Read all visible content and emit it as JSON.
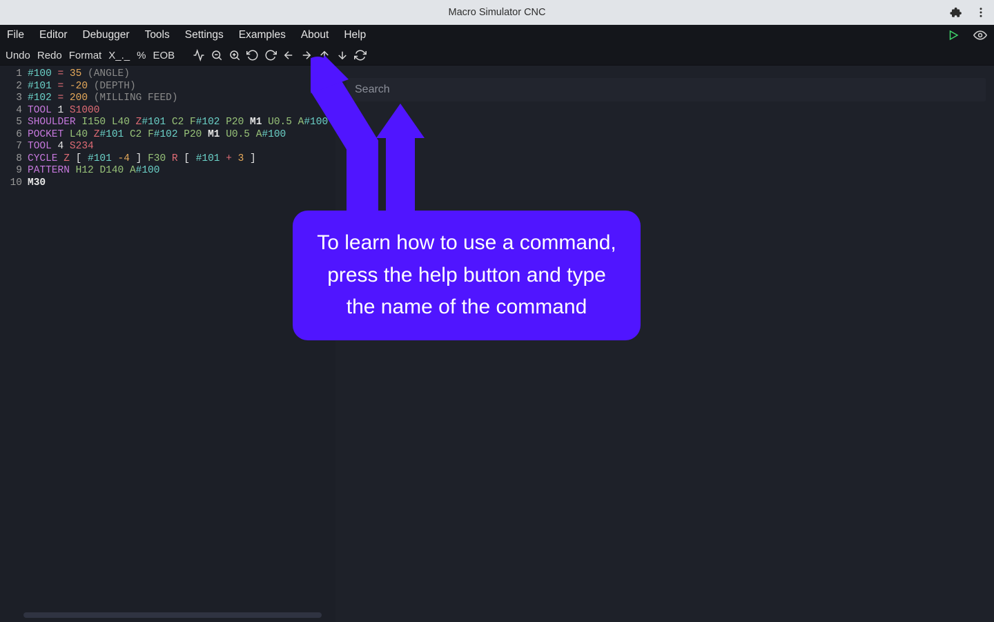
{
  "titlebar": {
    "title": "Macro Simulator CNC"
  },
  "menu": {
    "items": [
      "File",
      "Editor",
      "Debugger",
      "Tools",
      "Settings",
      "Examples",
      "About",
      "Help"
    ]
  },
  "toolbar": {
    "undo": "Undo",
    "redo": "Redo",
    "format": "Format",
    "xdot": "X_._",
    "percent": "%",
    "eob": "EOB"
  },
  "search": {
    "placeholder": "Search"
  },
  "callout": {
    "text": "To learn how to use a command, press the help button and type the name of the command"
  },
  "code": {
    "lines": [
      [
        {
          "t": "#100",
          "c": "cyan"
        },
        {
          "t": " "
        },
        {
          "t": "=",
          "c": "red"
        },
        {
          "t": " "
        },
        {
          "t": "35",
          "c": "orange"
        },
        {
          "t": " "
        },
        {
          "t": "(ANGLE)",
          "c": "comment"
        }
      ],
      [
        {
          "t": "#101",
          "c": "cyan"
        },
        {
          "t": " "
        },
        {
          "t": "=",
          "c": "red"
        },
        {
          "t": " "
        },
        {
          "t": "-20",
          "c": "orange"
        },
        {
          "t": " "
        },
        {
          "t": "(DEPTH)",
          "c": "comment"
        }
      ],
      [
        {
          "t": "#102",
          "c": "cyan"
        },
        {
          "t": " "
        },
        {
          "t": "=",
          "c": "red"
        },
        {
          "t": " "
        },
        {
          "t": "200",
          "c": "orange"
        },
        {
          "t": " "
        },
        {
          "t": "(MILLING FEED)",
          "c": "comment"
        }
      ],
      [
        {
          "t": "TOOL",
          "c": "magenta"
        },
        {
          "t": " "
        },
        {
          "t": "1",
          "c": "white"
        },
        {
          "t": " "
        },
        {
          "t": "S1000",
          "c": "red"
        }
      ],
      [
        {
          "t": "SHOULDER",
          "c": "magenta"
        },
        {
          "t": " "
        },
        {
          "t": "I150",
          "c": "green"
        },
        {
          "t": " "
        },
        {
          "t": "L40",
          "c": "green"
        },
        {
          "t": " "
        },
        {
          "t": "Z",
          "c": "red"
        },
        {
          "t": "#101",
          "c": "cyan"
        },
        {
          "t": " "
        },
        {
          "t": "C2",
          "c": "green"
        },
        {
          "t": " "
        },
        {
          "t": "F",
          "c": "green"
        },
        {
          "t": "#102",
          "c": "cyan"
        },
        {
          "t": " "
        },
        {
          "t": "P20",
          "c": "green"
        },
        {
          "t": " "
        },
        {
          "t": "M1",
          "c": "white",
          "b": true
        },
        {
          "t": " "
        },
        {
          "t": "U0.5",
          "c": "green"
        },
        {
          "t": " "
        },
        {
          "t": "A",
          "c": "green"
        },
        {
          "t": "#100",
          "c": "cyan"
        }
      ],
      [
        {
          "t": "POCKET",
          "c": "magenta"
        },
        {
          "t": " "
        },
        {
          "t": "L40",
          "c": "green"
        },
        {
          "t": " "
        },
        {
          "t": "Z",
          "c": "red"
        },
        {
          "t": "#101",
          "c": "cyan"
        },
        {
          "t": " "
        },
        {
          "t": "C2",
          "c": "green"
        },
        {
          "t": " "
        },
        {
          "t": "F",
          "c": "green"
        },
        {
          "t": "#102",
          "c": "cyan"
        },
        {
          "t": " "
        },
        {
          "t": "P20",
          "c": "green"
        },
        {
          "t": " "
        },
        {
          "t": "M1",
          "c": "white",
          "b": true
        },
        {
          "t": " "
        },
        {
          "t": "U0.5",
          "c": "green"
        },
        {
          "t": " "
        },
        {
          "t": "A",
          "c": "green"
        },
        {
          "t": "#100",
          "c": "cyan"
        }
      ],
      [
        {
          "t": "TOOL",
          "c": "magenta"
        },
        {
          "t": " "
        },
        {
          "t": "4",
          "c": "white"
        },
        {
          "t": " "
        },
        {
          "t": "S234",
          "c": "red"
        }
      ],
      [
        {
          "t": "CYCLE",
          "c": "magenta"
        },
        {
          "t": " "
        },
        {
          "t": "Z",
          "c": "red"
        },
        {
          "t": " "
        },
        {
          "t": "[",
          "c": "white"
        },
        {
          "t": " "
        },
        {
          "t": "#101",
          "c": "cyan"
        },
        {
          "t": " "
        },
        {
          "t": "-4",
          "c": "orange"
        },
        {
          "t": " "
        },
        {
          "t": "]",
          "c": "white"
        },
        {
          "t": " "
        },
        {
          "t": "F30",
          "c": "green"
        },
        {
          "t": " "
        },
        {
          "t": "R",
          "c": "red"
        },
        {
          "t": " "
        },
        {
          "t": "[",
          "c": "white"
        },
        {
          "t": " "
        },
        {
          "t": "#101",
          "c": "cyan"
        },
        {
          "t": " "
        },
        {
          "t": "+",
          "c": "red"
        },
        {
          "t": " "
        },
        {
          "t": "3",
          "c": "orange"
        },
        {
          "t": " "
        },
        {
          "t": "]",
          "c": "white"
        }
      ],
      [
        {
          "t": "PATTERN",
          "c": "magenta"
        },
        {
          "t": " "
        },
        {
          "t": "H12",
          "c": "green"
        },
        {
          "t": " "
        },
        {
          "t": "D140",
          "c": "green"
        },
        {
          "t": " "
        },
        {
          "t": "A",
          "c": "green"
        },
        {
          "t": "#100",
          "c": "cyan"
        }
      ],
      [
        {
          "t": "M30",
          "c": "white",
          "b": true
        }
      ]
    ]
  }
}
